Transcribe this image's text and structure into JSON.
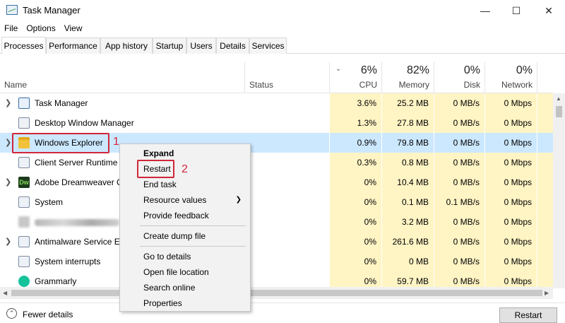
{
  "window": {
    "title": "Task Manager",
    "controls": {
      "minimize": "—",
      "maximize": "☐",
      "close": "✕"
    }
  },
  "menu": [
    "File",
    "Options",
    "View"
  ],
  "tabs": [
    "Processes",
    "Performance",
    "App history",
    "Startup",
    "Users",
    "Details",
    "Services"
  ],
  "active_tab": "Processes",
  "columns": {
    "name": "Name",
    "status": "Status",
    "cpu": {
      "pct": "6%",
      "label": "CPU"
    },
    "memory": {
      "pct": "82%",
      "label": "Memory"
    },
    "disk": {
      "pct": "0%",
      "label": "Disk"
    },
    "network": {
      "pct": "0%",
      "label": "Network"
    }
  },
  "processes": [
    {
      "name": "Task Manager",
      "expandable": true,
      "icon": "task-manager-icon",
      "cpu": "3.6%",
      "memory": "25.2 MB",
      "disk": "0 MB/s",
      "network": "0 Mbps"
    },
    {
      "name": "Desktop Window Manager",
      "expandable": false,
      "icon": "dwm-icon",
      "cpu": "1.3%",
      "memory": "27.8 MB",
      "disk": "0 MB/s",
      "network": "0 Mbps"
    },
    {
      "name": "Windows Explorer",
      "expandable": true,
      "icon": "folder-icon",
      "cpu": "0.9%",
      "memory": "79.8 MB",
      "disk": "0 MB/s",
      "network": "0 Mbps",
      "selected": true
    },
    {
      "name": "Client Server Runtime P",
      "expandable": false,
      "icon": "app-icon",
      "cpu": "0.3%",
      "memory": "0.8 MB",
      "disk": "0 MB/s",
      "network": "0 Mbps"
    },
    {
      "name": "Adobe Dreamweaver C",
      "expandable": true,
      "icon": "dreamweaver-icon",
      "cpu": "0%",
      "memory": "10.4 MB",
      "disk": "0 MB/s",
      "network": "0 Mbps"
    },
    {
      "name": "System",
      "expandable": false,
      "icon": "system-icon",
      "cpu": "0%",
      "memory": "0.1 MB",
      "disk": "0.1 MB/s",
      "network": "0 Mbps"
    },
    {
      "name": "",
      "expandable": false,
      "icon": "blurred-icon",
      "blurred": true,
      "cpu": "0%",
      "memory": "3.2 MB",
      "disk": "0 MB/s",
      "network": "0 Mbps"
    },
    {
      "name": "Antimalware Service Ex",
      "expandable": true,
      "icon": "shield-icon",
      "cpu": "0%",
      "memory": "261.6 MB",
      "disk": "0 MB/s",
      "network": "0 Mbps"
    },
    {
      "name": "System interrupts",
      "expandable": false,
      "icon": "system-icon",
      "cpu": "0%",
      "memory": "0 MB",
      "disk": "0 MB/s",
      "network": "0 Mbps"
    },
    {
      "name": "Grammarly",
      "expandable": false,
      "icon": "grammarly-icon",
      "cpu": "0%",
      "memory": "59.7 MB",
      "disk": "0 MB/s",
      "network": "0 Mbps"
    }
  ],
  "context_menu": {
    "items": [
      "Expand",
      "Restart",
      "End task",
      "Resource values",
      "Provide feedback",
      "Create dump file",
      "Go to details",
      "Open file location",
      "Search online",
      "Properties"
    ]
  },
  "annotations": {
    "step1": "1",
    "step2": "2"
  },
  "footer": {
    "fewer_details": "Fewer details",
    "restart_button": "Restart"
  },
  "colors": {
    "heat": "#fff4c4",
    "selected": "#cce8ff",
    "annotation": "#d0263a"
  }
}
